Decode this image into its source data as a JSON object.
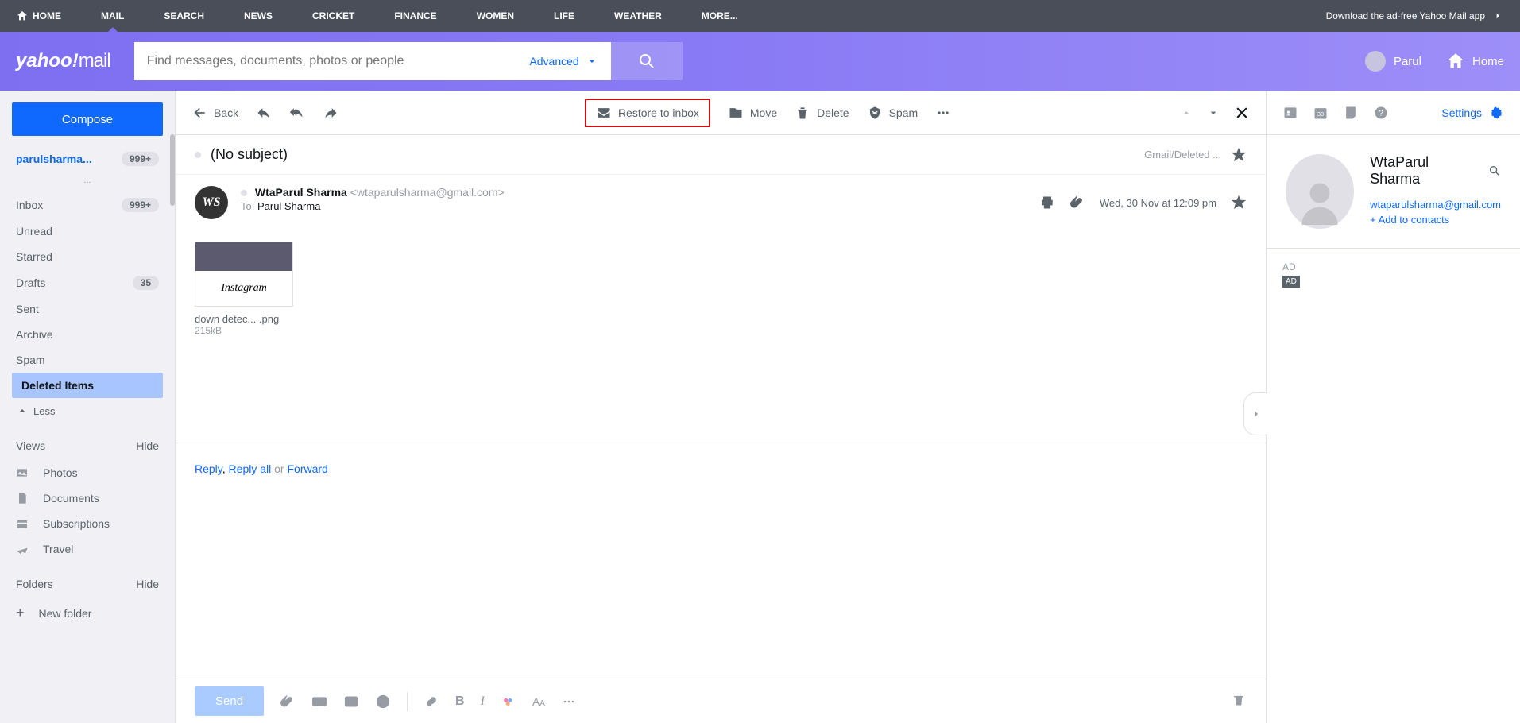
{
  "topnav": {
    "items": [
      "HOME",
      "MAIL",
      "SEARCH",
      "NEWS",
      "CRICKET",
      "FINANCE",
      "WOMEN",
      "LIFE",
      "WEATHER",
      "MORE..."
    ],
    "download_text": "Download the ad-free Yahoo Mail app"
  },
  "header": {
    "logo_prefix": "yahoo",
    "logo_suffix": "mail",
    "search_placeholder": "Find messages, documents, photos or people",
    "advanced": "Advanced",
    "user_name": "Parul",
    "home_label": "Home"
  },
  "sidebar": {
    "compose": "Compose",
    "account": "parulsharma...",
    "account_badge": "999+",
    "folders": [
      {
        "name": "Inbox",
        "badge": "999+",
        "selected": false
      },
      {
        "name": "Unread",
        "badge": "",
        "selected": false
      },
      {
        "name": "Starred",
        "badge": "",
        "selected": false
      },
      {
        "name": "Drafts",
        "badge": "35",
        "selected": false
      },
      {
        "name": "Sent",
        "badge": "",
        "selected": false
      },
      {
        "name": "Archive",
        "badge": "",
        "selected": false
      },
      {
        "name": "Spam",
        "badge": "",
        "selected": false
      },
      {
        "name": "Deleted Items",
        "badge": "",
        "selected": true
      }
    ],
    "less": "Less",
    "views_header": "Views",
    "hide": "Hide",
    "views": [
      "Photos",
      "Documents",
      "Subscriptions",
      "Travel"
    ],
    "folders_header": "Folders",
    "new_folder": "New folder",
    "dots": "..."
  },
  "toolbar": {
    "back": "Back",
    "restore": "Restore to inbox",
    "move": "Move",
    "delete": "Delete",
    "spam": "Spam"
  },
  "message": {
    "subject": "(No subject)",
    "location": "Gmail/Deleted ...",
    "sender_name": "WtaParul Sharma",
    "sender_email": "<wtaparulsharma@gmail.com>",
    "to_label": "To:",
    "to_name": "Parul Sharma",
    "date": "Wed, 30 Nov at 12:09 pm",
    "avatar_initials": "WS",
    "attachment": {
      "name": "down detec... .png",
      "size": "215kB",
      "thumb_label": "Instagram"
    }
  },
  "reply": {
    "reply": "Reply",
    "reply_all": "Reply all",
    "or": "or",
    "forward": "Forward"
  },
  "composer": {
    "send": "Send"
  },
  "right": {
    "settings": "Settings",
    "contact_name": "WtaParul Sharma",
    "contact_email": "wtaparulsharma@gmail.com",
    "add_contact": "+ Add to contacts",
    "ad_label": "AD",
    "ad_badge": "AD"
  }
}
